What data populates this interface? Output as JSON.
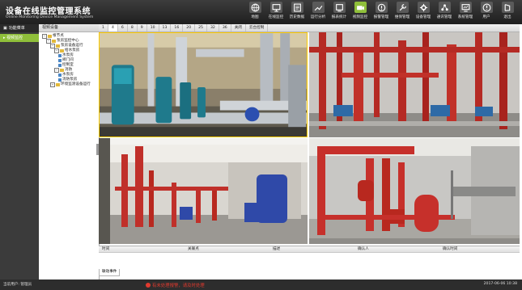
{
  "header": {
    "title": "设备在线监控管理系统",
    "subtitle": "Online Monitoring Device Management System",
    "toolbar": [
      {
        "label": "地图",
        "icon": "globe-icon"
      },
      {
        "label": "在线监控",
        "icon": "monitor-icon"
      },
      {
        "label": "历史数据",
        "icon": "history-icon"
      },
      {
        "label": "运行分析",
        "icon": "analysis-icon"
      },
      {
        "label": "报表统计",
        "icon": "report-icon"
      },
      {
        "label": "视频监控",
        "icon": "camera-icon"
      },
      {
        "label": "报警管理",
        "icon": "alarm-icon"
      },
      {
        "label": "维保管理",
        "icon": "wrench-icon"
      },
      {
        "label": "设备管理",
        "icon": "gear-icon"
      },
      {
        "label": "通讯管理",
        "icon": "network-icon"
      },
      {
        "label": "系统管理",
        "icon": "settings-monitor-icon"
      },
      {
        "label": "用户",
        "icon": "user-icon"
      },
      {
        "label": "退出",
        "icon": "exit-icon"
      }
    ]
  },
  "left_panel": {
    "header": "功能菜单",
    "items": [
      {
        "label": "视频监控"
      }
    ]
  },
  "tree_panel": {
    "header": "视频设备",
    "nodes": [
      {
        "label": "根节点",
        "level": 0,
        "toggle": "−",
        "kind": "folder"
      },
      {
        "label": "泵房监控中心",
        "level": 1,
        "toggle": "−",
        "kind": "folder"
      },
      {
        "label": "泵房设备运行",
        "level": 2,
        "toggle": "−",
        "kind": "folder"
      },
      {
        "label": "给水泵房",
        "level": 3,
        "toggle": "−",
        "kind": "folder"
      },
      {
        "label": "水泵房",
        "level": 4,
        "toggle": "",
        "kind": "camera"
      },
      {
        "label": "阀门间",
        "level": 4,
        "toggle": "",
        "kind": "camera"
      },
      {
        "label": "控制室",
        "level": 4,
        "toggle": "",
        "kind": "camera"
      },
      {
        "label": "消防",
        "level": 3,
        "toggle": "−",
        "kind": "folder"
      },
      {
        "label": "水泵房",
        "level": 4,
        "toggle": "",
        "kind": "camera"
      },
      {
        "label": "消防泵房",
        "level": 4,
        "toggle": "",
        "kind": "camera"
      },
      {
        "label": "环境监测设备运行",
        "level": 2,
        "toggle": "+",
        "kind": "folder"
      }
    ]
  },
  "tabs": [
    "1",
    "4",
    "6",
    "8",
    "9",
    "10",
    "13",
    "16",
    "20",
    "25",
    "32",
    "36",
    "关闭",
    "云台控制"
  ],
  "active_tab": 1,
  "events": {
    "columns": [
      "时间",
      "关联点",
      "描述",
      "确认人",
      "确认时间"
    ],
    "tab_label": "联动事件"
  },
  "status": {
    "left": "当前用户: 管理员",
    "alert": "有未处理报警，请及时处理",
    "right": "2017-06-06 10:38"
  },
  "colors": {
    "accent": "#8fbf3a",
    "header_bg": "#2b2b2b",
    "alert": "#e23a2e"
  }
}
